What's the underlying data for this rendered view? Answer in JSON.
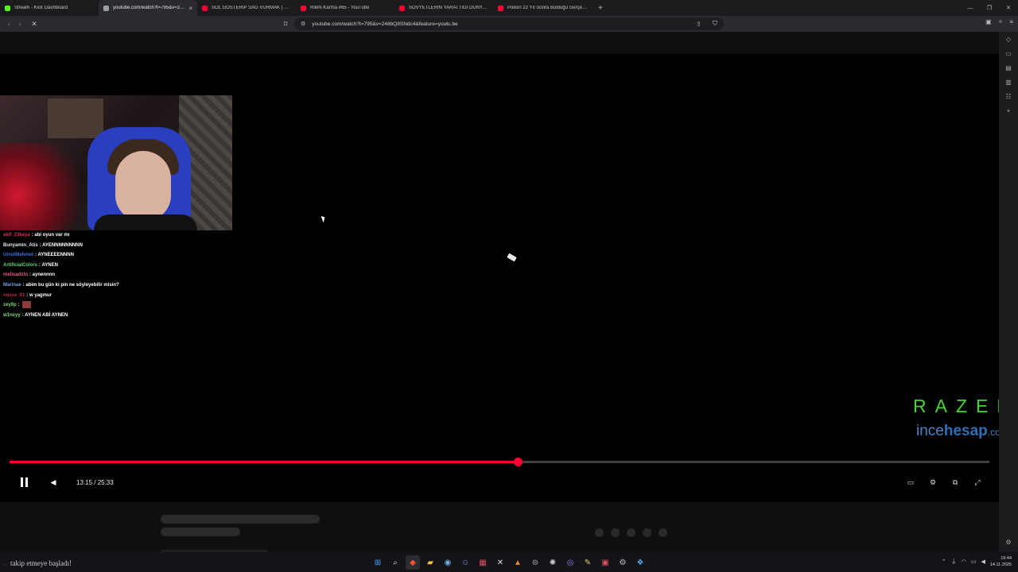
{
  "tabs": [
    {
      "title": "Stream - Kick Dashboard",
      "favicon_color": "#53fc18",
      "active": false
    },
    {
      "title": "youtube.com/watch?t=795&v=248bQ8SNdc4&feature=youtu.be",
      "favicon_color": "#9aa0a6",
      "active": true
    },
    {
      "title": "SOL GÖSTERİP SAĞ VURMAK | Sinirli",
      "favicon_color": "#ff0033",
      "active": false
    },
    {
      "title": "RileN Karma #65 - YouTube",
      "favicon_color": "#ff0033",
      "active": false
    },
    {
      "title": "SOVYETLERİN YARATTIĞI DÜNYANIN EN",
      "favicon_color": "#ff0033",
      "active": false
    },
    {
      "title": "Polisin 22 Yıl Sonra Bulduğu Gerçek Katil",
      "favicon_color": "#ff0033",
      "active": false
    }
  ],
  "address_bar": {
    "url": "youtube.com/watch?t=795&v=248bQ8SNdc4&feature=youtu.be"
  },
  "chat": [
    {
      "user": "akif_23kaya",
      "color": "#d6304a",
      "message": ": abi oyun var mı"
    },
    {
      "user": "Bunyamin_Atis",
      "color": "#e7e7e7",
      "message": ": AYENNNNNNNNN"
    },
    {
      "user": "UmutMehmet",
      "color": "#3d6fdc",
      "message": ": AYNEEEENNNN"
    },
    {
      "user": "ArtificialColors",
      "color": "#61d47a",
      "message": ": AYNEN"
    },
    {
      "user": "melisadztn",
      "color": "#e25a8f",
      "message": ": aynennnn"
    },
    {
      "user": "Marinae",
      "color": "#6aa0e8",
      "message": ": abim bu gün ki pin ne söyleyebilir misin?"
    },
    {
      "user": "nusse_61",
      "color": "#c0283e",
      "message": ": w yagmur"
    },
    {
      "user": "zey9p",
      "color": "#79d36b",
      "message": ":",
      "emote": true
    },
    {
      "user": "w1ncyy",
      "color": "#7fe06a",
      "message": ": AYNEN ABİ AYNEN"
    }
  ],
  "overlay": {
    "razer": "RAZER",
    "ince": "ince",
    "hesap": "hesap",
    "dotcom": ".com"
  },
  "player": {
    "time_text": "13:15 / 25:33",
    "progress_fraction": 0.5186,
    "accent": "#ff0033"
  },
  "taskbar": {
    "notify_user": "...",
    "notify_text": "takip etmeye başladı!",
    "time": "19:44",
    "date": "14.11.2025"
  }
}
